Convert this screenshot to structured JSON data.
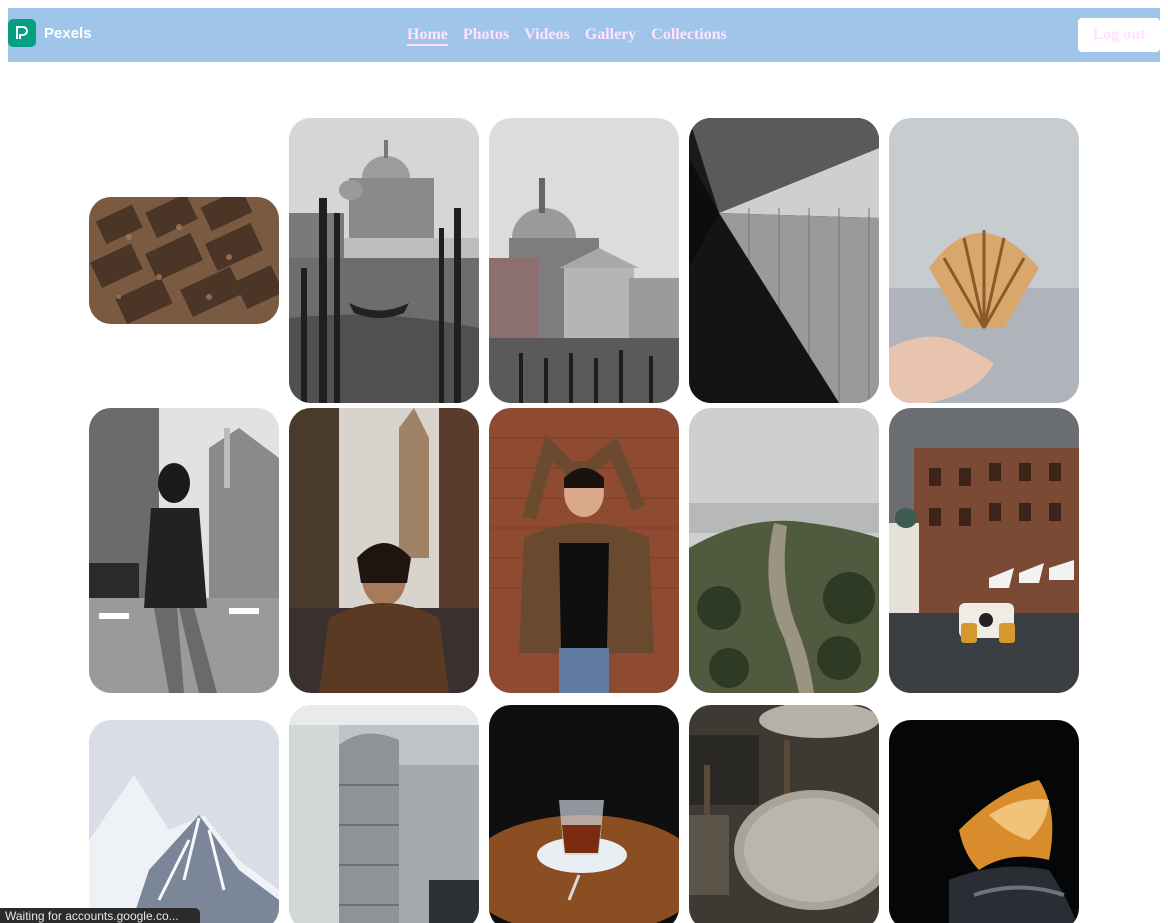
{
  "brand": {
    "name": "Pexels",
    "accent": "#05a081"
  },
  "navbar": {
    "background": "#9fc5e8",
    "links": [
      {
        "label": "Home",
        "active": true
      },
      {
        "label": "Photos",
        "active": false
      },
      {
        "label": "Videos",
        "active": false
      },
      {
        "label": "Gallery",
        "active": false
      },
      {
        "label": "Collections",
        "active": false
      }
    ],
    "logout_label": "Log out"
  },
  "gallery": {
    "photos": [
      {
        "subject": "market-stalls-aerial"
      },
      {
        "subject": "venice-basilica-gondolas"
      },
      {
        "subject": "venice-church-dome"
      },
      {
        "subject": "abstract-glass-building"
      },
      {
        "subject": "scallop-shell-in-hand"
      },
      {
        "subject": "woman-on-city-street"
      },
      {
        "subject": "woman-in-brown-jacket-street"
      },
      {
        "subject": "woman-posing-brick-wall"
      },
      {
        "subject": "hillside-path"
      },
      {
        "subject": "vintage-car-on-street"
      },
      {
        "subject": "snowy-mountain-peak"
      },
      {
        "subject": "industrial-metal-ducts"
      },
      {
        "subject": "tea-glass-on-table"
      },
      {
        "subject": "cafe-round-table"
      },
      {
        "subject": "canyon-rock-formation"
      }
    ]
  },
  "status_bar": {
    "text": "Waiting for accounts.google.co..."
  }
}
